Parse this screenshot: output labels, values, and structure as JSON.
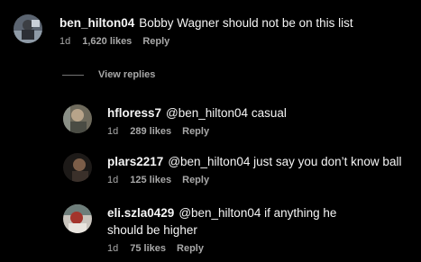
{
  "top_comment": {
    "username": "ben_hilton04",
    "text": "Bobby Wagner should not be on this list",
    "time": "1d",
    "likes": "1,620 likes",
    "reply_label": "Reply"
  },
  "view_replies_label": "View replies",
  "replies": [
    {
      "username": "hfloress7",
      "mention": "@ben_hilton04",
      "text": "casual",
      "time": "1d",
      "likes": "289 likes",
      "reply_label": "Reply"
    },
    {
      "username": "plars2217",
      "mention": "@ben_hilton04",
      "text": "just say you don’t know ball",
      "time": "1d",
      "likes": "125 likes",
      "reply_label": "Reply"
    },
    {
      "username": "eli.szla0429",
      "mention": "@ben_hilton04",
      "text": "if anything he should be higher",
      "time": "1d",
      "likes": "75 likes",
      "reply_label": "Reply"
    }
  ],
  "colors": {
    "background": "#000000",
    "primary_text": "#f5f5f5",
    "secondary_text": "#a8a8a8",
    "divider": "#737373"
  },
  "icons": [
    "avatar-photo"
  ]
}
